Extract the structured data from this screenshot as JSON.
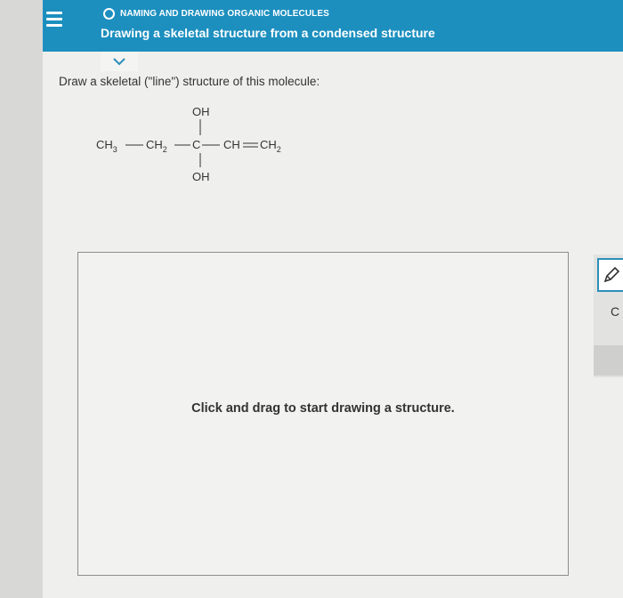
{
  "header": {
    "topic": "NAMING AND DRAWING ORGANIC MOLECULES",
    "title": "Drawing a skeletal structure from a condensed structure"
  },
  "question": {
    "prompt": "Draw a skeletal (\"line\") structure of this molecule:"
  },
  "molecule": {
    "top_group": "OH",
    "bottom_group": "OH",
    "chain": [
      "CH3",
      "CH2",
      "C",
      "CH",
      "CH2"
    ]
  },
  "canvas": {
    "hint": "Click and drag to start drawing a structure."
  },
  "toolbar": {
    "tool_c_label": "C"
  },
  "colors": {
    "header": "#1c8fbf",
    "accent": "#2d8fb8"
  },
  "icons": [
    "menu-icon",
    "topic-status-icon",
    "chevron-down-icon",
    "pencil-icon"
  ]
}
